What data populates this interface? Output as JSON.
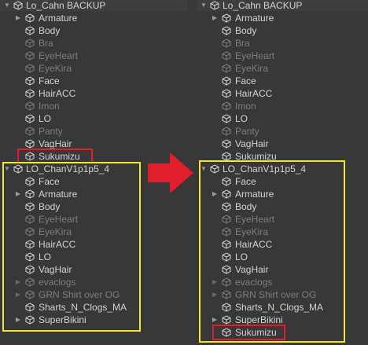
{
  "colors": {
    "background": "#383838",
    "text": "#d2d2d2",
    "inactive_text": "#7d7d7d",
    "yellow_highlight": "#f2e62f",
    "red_highlight": "#e01d2a"
  },
  "left": {
    "root_a": {
      "label": "Lo_Cahn BACKUP",
      "children": [
        "Armature",
        "Body",
        "Bra",
        "EyeHeart",
        "EyeKira",
        "Face",
        "HairACC",
        "Imon",
        "LO",
        "Panty",
        "VagHair",
        "Sukumizu"
      ]
    },
    "root_b": {
      "label": "LO_ChanV1p1p5_4",
      "children": [
        "Face",
        "Armature",
        "Body",
        "EyeHeart",
        "EyeKira",
        "HairACC",
        "LO",
        "VagHair",
        "evaclogs",
        "GRN Shirt over OG",
        "Sharts_N_Clogs_MA",
        "SuperBikini"
      ]
    }
  },
  "right": {
    "root_a": {
      "label": "Lo_Cahn BACKUP",
      "children": [
        "Armature",
        "Body",
        "Bra",
        "EyeHeart",
        "EyeKira",
        "Face",
        "HairACC",
        "Imon",
        "LO",
        "Panty",
        "VagHair",
        "Sukumizu"
      ]
    },
    "root_b": {
      "label": "LO_ChanV1p1p5_4",
      "children": [
        "Face",
        "Armature",
        "Body",
        "EyeHeart",
        "EyeKira",
        "HairACC",
        "LO",
        "VagHair",
        "evaclogs",
        "GRN Shirt over OG",
        "Sharts_N_Clogs_MA",
        "SuperBikini",
        "Sukumizu"
      ]
    }
  }
}
